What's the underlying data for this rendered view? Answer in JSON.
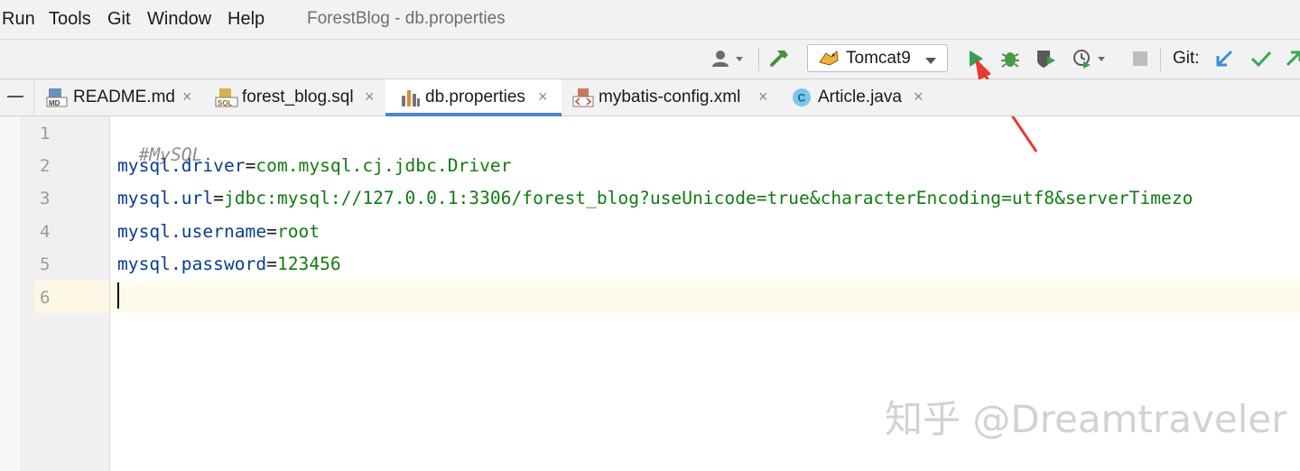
{
  "menu": {
    "items": [
      "Run",
      "Tools",
      "Git",
      "Window",
      "Help"
    ],
    "window_title": "ForestBlog - db.properties"
  },
  "toolbar": {
    "run_config": "Tomcat9",
    "git_label": "Git:",
    "icons": [
      "user-icon",
      "hammer-icon",
      "tomcat-icon",
      "run-icon",
      "debug-icon",
      "coverage-icon",
      "profiler-icon",
      "stop-icon",
      "git-update-icon",
      "git-commit-icon",
      "git-push-icon"
    ],
    "colors": {
      "run": "#2ea44f",
      "debug": "#4a9a4a",
      "git_update": "#3a8ed6",
      "git_commit": "#3aa650",
      "annotation_arrow": "#e53935"
    }
  },
  "tabs": [
    {
      "label": "README.md",
      "icon": "markdown-icon",
      "active": false
    },
    {
      "label": "forest_blog.sql",
      "icon": "sql-icon",
      "active": false
    },
    {
      "label": "db.properties",
      "icon": "properties-icon",
      "active": true
    },
    {
      "label": "mybatis-config.xml",
      "icon": "xml-icon",
      "active": false
    },
    {
      "label": "Article.java",
      "icon": "java-class-icon",
      "active": false
    }
  ],
  "tab_close": "×",
  "editor": {
    "line_numbers": [
      "1",
      "2",
      "3",
      "4",
      "5",
      "6"
    ],
    "lines": [
      {
        "comment": "#MySQL"
      },
      {
        "key": "mysql.driver",
        "eq": "=",
        "value": "com.mysql.cj.jdbc.Driver"
      },
      {
        "key": "mysql.url",
        "eq": "=",
        "value": "jdbc:mysql://127.0.0.1:3306/forest_blog?useUnicode=true&characterEncoding=utf8&serverTimezo"
      },
      {
        "key": "mysql.username",
        "eq": "=",
        "value": "root"
      },
      {
        "key": "mysql.password",
        "eq": "=",
        "value": "123456"
      }
    ]
  },
  "watermark": "知乎 @Dreamtraveler"
}
